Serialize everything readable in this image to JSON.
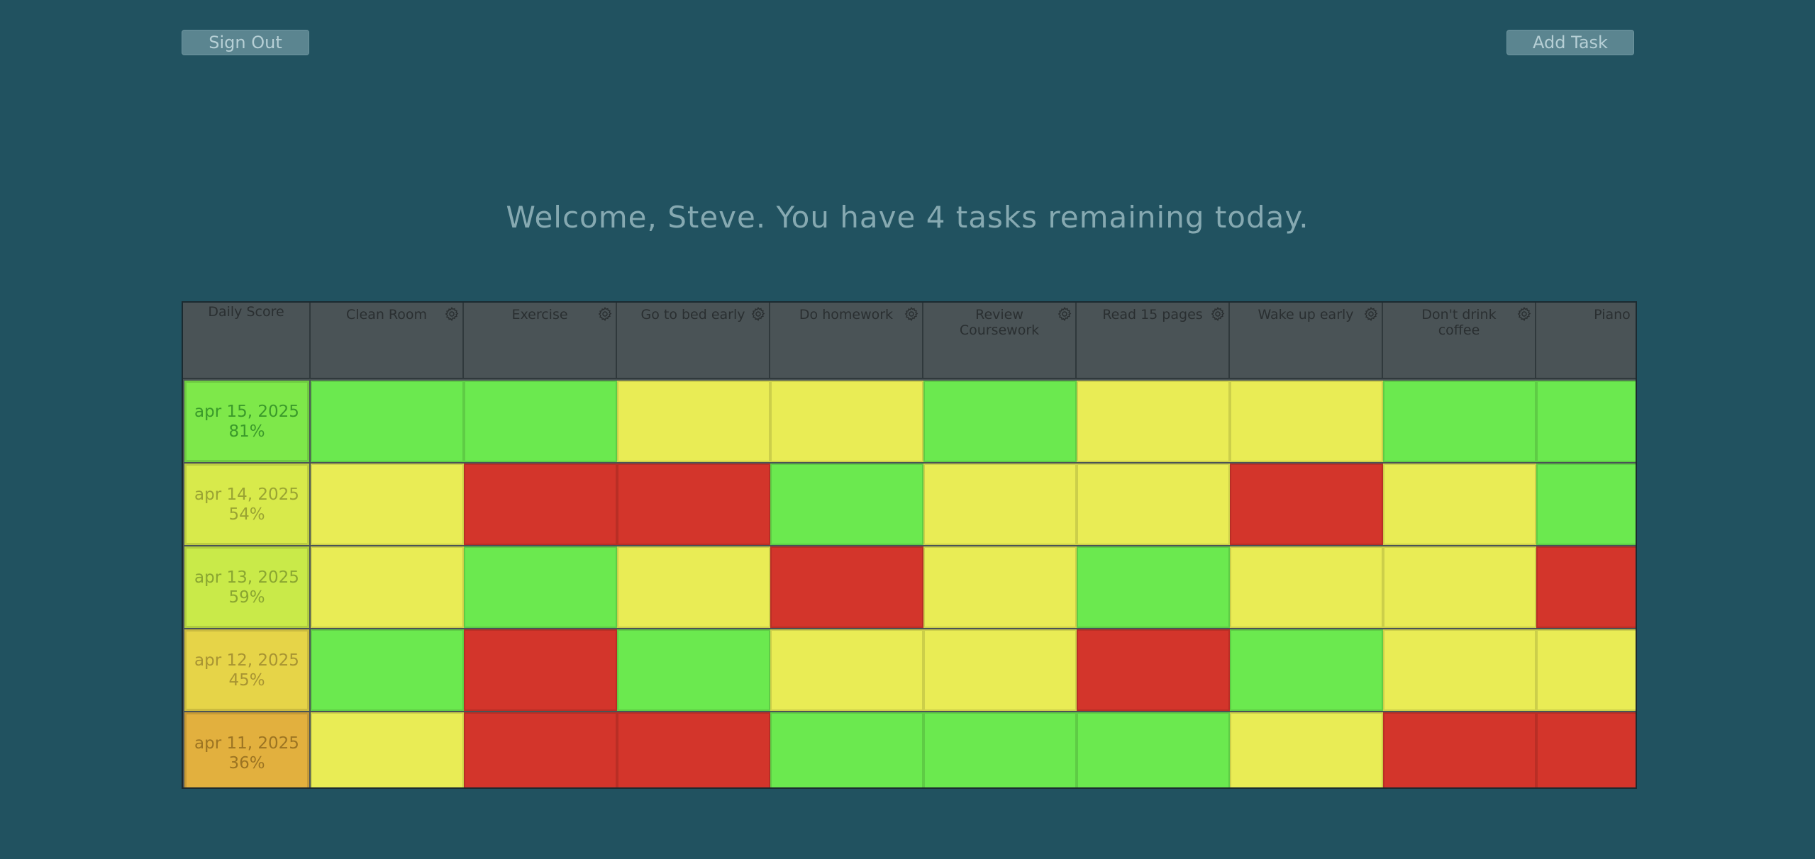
{
  "header": {
    "sign_out_label": "Sign Out",
    "add_task_label": "Add Task",
    "welcome_text": "Welcome, Steve. You have 4 tasks remaining today."
  },
  "colors": {
    "green": "#6be94f",
    "yellow": "#e9ec55",
    "red": "#d3352b",
    "header_bg": "#4a5356",
    "page_bg": "#215260"
  },
  "grid": {
    "score_header": "Daily Score",
    "tasks": [
      {
        "name": "Clean Room",
        "icon": "gear-icon"
      },
      {
        "name": "Exercise",
        "icon": "gear-icon"
      },
      {
        "name": "Go to bed early",
        "icon": "gear-icon"
      },
      {
        "name": "Do homework",
        "icon": "gear-icon"
      },
      {
        "name": "Review Coursework",
        "icon": "gear-icon"
      },
      {
        "name": "Read 15 pages",
        "icon": "gear-icon"
      },
      {
        "name": "Wake up early",
        "icon": "gear-icon"
      },
      {
        "name": "Don't drink coffee",
        "icon": "gear-icon"
      },
      {
        "name": "Piano",
        "icon": "gear-icon"
      }
    ],
    "days": [
      {
        "date": "apr 15, 2025",
        "score": "81%",
        "score_color": "#7ee84a",
        "text_color": "#3a9a2a",
        "statuses": [
          "green",
          "green",
          "yellow",
          "yellow",
          "green",
          "yellow",
          "yellow",
          "green",
          "green"
        ]
      },
      {
        "date": "apr 14, 2025",
        "score": "54%",
        "score_color": "#d8ea4b",
        "text_color": "#9aa433",
        "statuses": [
          "yellow",
          "red",
          "red",
          "green",
          "yellow",
          "yellow",
          "red",
          "yellow",
          "green"
        ]
      },
      {
        "date": "apr 13, 2025",
        "score": "59%",
        "score_color": "#c9ea49",
        "text_color": "#8aa631",
        "statuses": [
          "yellow",
          "green",
          "yellow",
          "red",
          "yellow",
          "green",
          "yellow",
          "yellow",
          "red"
        ]
      },
      {
        "date": "apr 12, 2025",
        "score": "45%",
        "score_color": "#e6d448",
        "text_color": "#a89432",
        "statuses": [
          "green",
          "red",
          "green",
          "yellow",
          "yellow",
          "red",
          "green",
          "yellow",
          "yellow"
        ]
      },
      {
        "date": "apr 11, 2025",
        "score": "36%",
        "score_color": "#e2b03e",
        "text_color": "#9c7422",
        "statuses": [
          "yellow",
          "red",
          "red",
          "green",
          "green",
          "green",
          "yellow",
          "red",
          "red"
        ]
      }
    ]
  }
}
